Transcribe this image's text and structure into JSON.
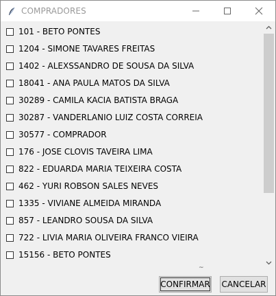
{
  "window": {
    "title": "COMPRADORES",
    "icon": "feather-icon"
  },
  "items": [
    {
      "label": "101 - BETO PONTES",
      "checked": false
    },
    {
      "label": "1204 - SIMONE TAVARES FREITAS",
      "checked": false
    },
    {
      "label": "1402 - ALEXSSANDRO DE SOUSA DA SILVA",
      "checked": false
    },
    {
      "label": "18041 - ANA PAULA MATOS DA SILVA",
      "checked": false
    },
    {
      "label": "30289 - CAMILA KACIA BATISTA BRAGA",
      "checked": false
    },
    {
      "label": "30287 - VANDERLANIO LUIZ COSTA CORREIA",
      "checked": false
    },
    {
      "label": "30577 - COMPRADOR",
      "checked": false
    },
    {
      "label": "176 - JOSE CLOVIS TAVEIRA LIMA",
      "checked": false
    },
    {
      "label": "822 - EDUARDA MARIA TEIXEIRA COSTA",
      "checked": false
    },
    {
      "label": "462 - YURI ROBSON SALES NEVES",
      "checked": false
    },
    {
      "label": "1335 - VIVIANE ALMEIDA MIRANDA",
      "checked": false
    },
    {
      "label": "857 - LEANDRO SOUSA DA SILVA",
      "checked": false
    },
    {
      "label": "722 - LIVIA MARIA OLIVEIRA FRANCO VIEIRA",
      "checked": false
    },
    {
      "label": "15156 - BETO PONTES",
      "checked": false
    }
  ],
  "buttons": {
    "confirm": "CONFIRMAR",
    "cancel": "CANCELAR"
  },
  "misc": {
    "tilde": "~"
  }
}
